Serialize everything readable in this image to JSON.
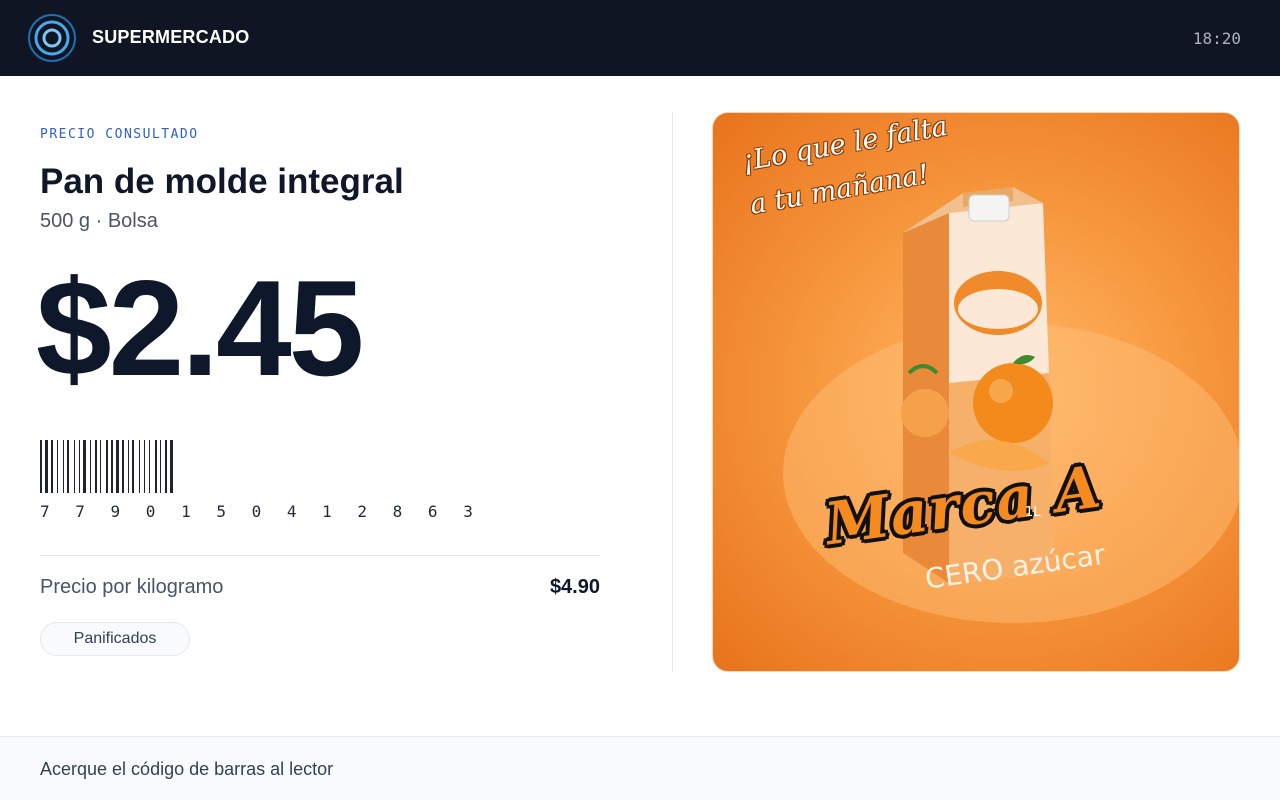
{
  "header": {
    "brand": "SUPERMERCADO",
    "time": "18:20",
    "logo_icon": "target-ring-icon"
  },
  "product": {
    "kicker": "PRECIO CONSULTADO",
    "name": "Pan de molde integral",
    "detail": "500 g · Bolsa",
    "price": "$2.45",
    "barcode": "7 7 9 0 1 5 0 4 1 2 8 6 3",
    "unit_price_label": "Precio por kilogramo",
    "unit_price_value": "$4.90",
    "category": "Panificados"
  },
  "ad": {
    "headline_line1": "¡Lo que le falta",
    "headline_line2": "a tu mañana!",
    "brand": "Marca A",
    "size": "1L",
    "tagline": "CERO azúcar"
  },
  "footer": {
    "instruction": "Acerque el código de barras al lector"
  },
  "colors": {
    "topbar": "#0f1522",
    "accent_blue": "#2f5fc8",
    "ad_orange": "#f7993f"
  }
}
